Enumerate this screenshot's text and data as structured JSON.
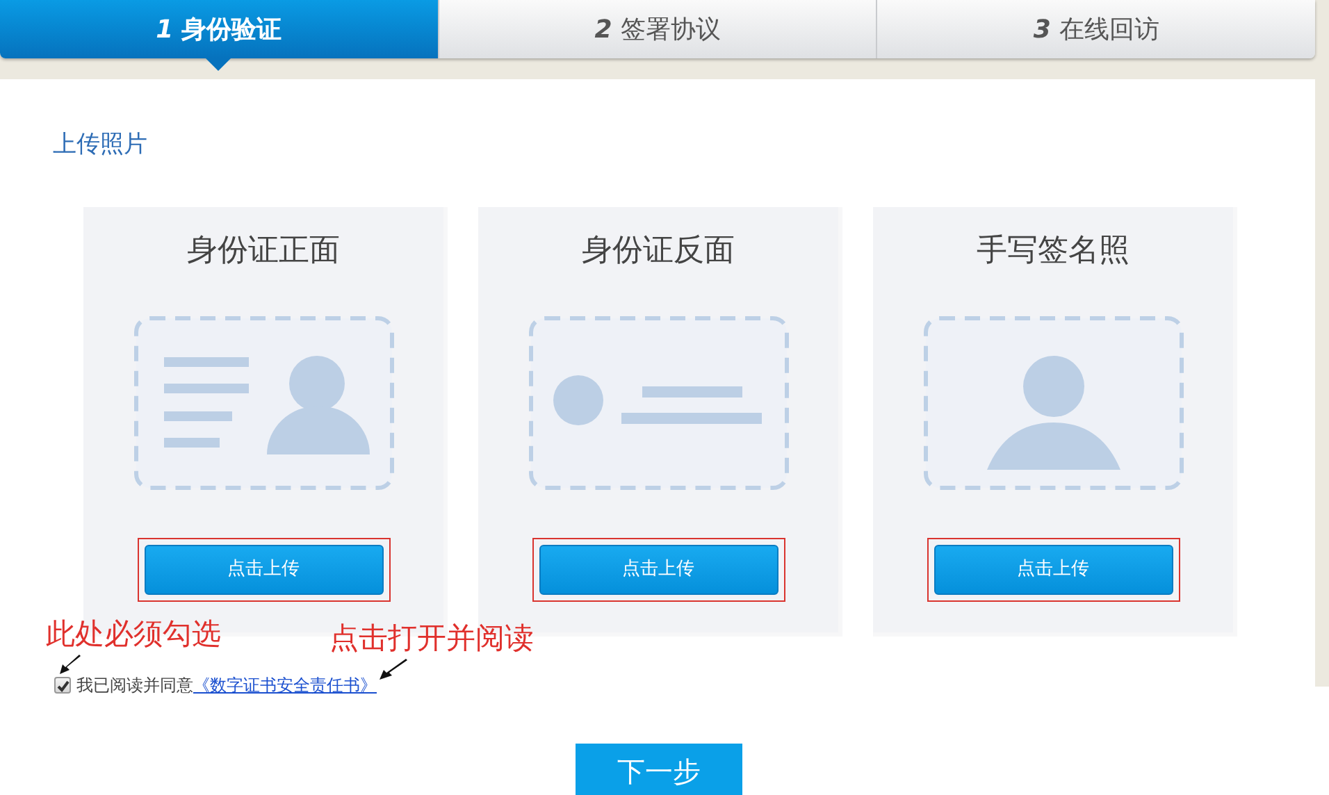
{
  "steps": [
    {
      "number": "1",
      "label": "身份验证",
      "selected": true
    },
    {
      "number": "2",
      "label": "签署协议",
      "selected": false
    },
    {
      "number": "3",
      "label": "在线回访",
      "selected": false
    }
  ],
  "section_title": "上传照片",
  "upload_cards": [
    {
      "title": "身份证正面",
      "kind": "id-front",
      "button": "点击上传"
    },
    {
      "title": "身份证反面",
      "kind": "id-back",
      "button": "点击上传"
    },
    {
      "title": "手写签名照",
      "kind": "portrait",
      "button": "点击上传"
    }
  ],
  "annotations": [
    "此处必须勾选",
    "点击打开并阅读"
  ],
  "agreement": {
    "checked": true,
    "text": "我已阅读并同意",
    "link": "《数字证书安全责任书》"
  },
  "next_button": "下一步"
}
